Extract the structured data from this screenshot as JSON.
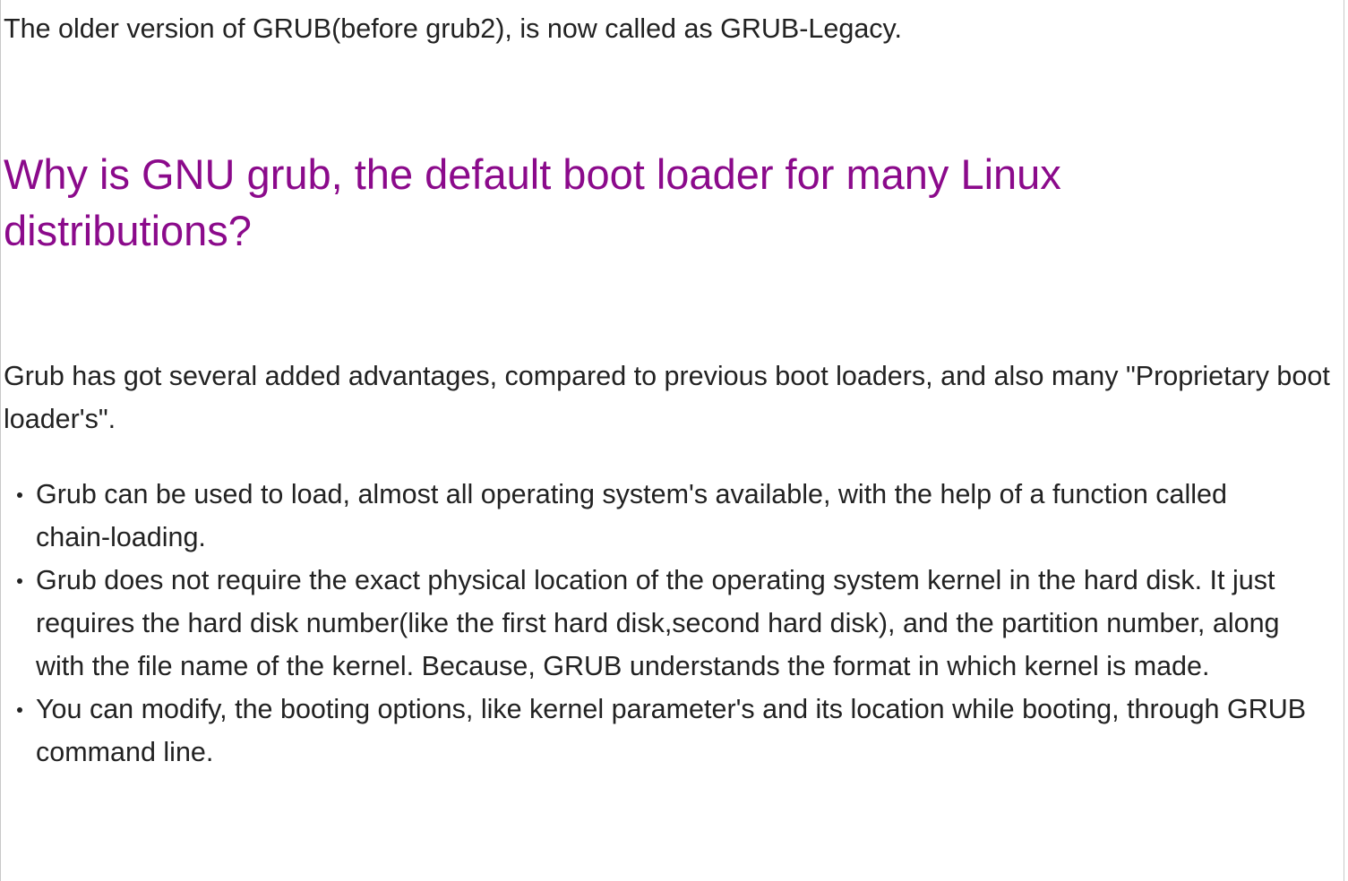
{
  "intro": {
    "text": "The older version of GRUB(before grub2), is now called as GRUB-Legacy."
  },
  "section": {
    "heading": "Why is GNU grub, the default boot loader for many Linux distributions?",
    "heading_color": "#8b0a8b",
    "paragraph": "Grub has got several added advantages, compared to previous boot loaders, and also many \"Proprietary boot loader's\".",
    "bullets": [
      "Grub can be used to load, almost all operating system's available, with the help of a function called chain-loading.",
      "Grub does not require the exact physical location of the operating system kernel in the hard disk. It just requires the hard disk number(like the first hard disk,second hard disk), and the partition number, along with the file name of the kernel. Because, GRUB understands the format in which kernel is made.",
      "You can modify, the booting options, like kernel parameter's and its location while booting, through GRUB command line."
    ]
  }
}
